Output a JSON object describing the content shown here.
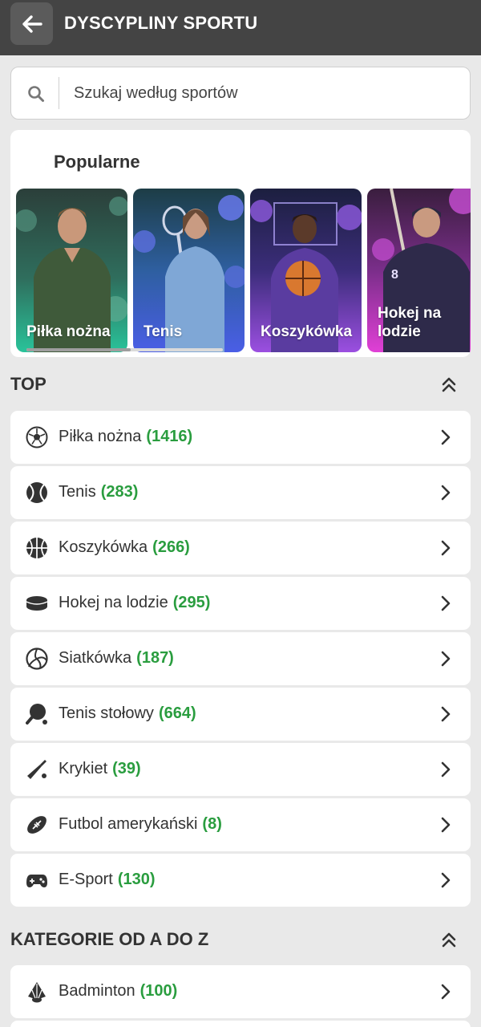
{
  "header": {
    "title": "DYSCYPLINY SPORTU"
  },
  "search": {
    "placeholder": "Szukaj według sportów"
  },
  "popular": {
    "title": "Popularne",
    "cards": [
      {
        "label": "Piłka nożna"
      },
      {
        "label": "Tenis"
      },
      {
        "label": "Koszykówka"
      },
      {
        "label": "Hokej na lodzie"
      }
    ]
  },
  "top": {
    "title": "TOP",
    "items": [
      {
        "label": "Piłka nożna",
        "count": "(1416)",
        "icon": "soccer-ball-icon"
      },
      {
        "label": "Tenis",
        "count": "(283)",
        "icon": "tennis-ball-icon"
      },
      {
        "label": "Koszykówka",
        "count": "(266)",
        "icon": "basketball-icon"
      },
      {
        "label": "Hokej na lodzie",
        "count": "(295)",
        "icon": "hockey-puck-icon"
      },
      {
        "label": "Siatkówka",
        "count": "(187)",
        "icon": "volleyball-icon"
      },
      {
        "label": "Tenis stołowy",
        "count": "(664)",
        "icon": "ping-pong-icon"
      },
      {
        "label": "Krykiet",
        "count": "(39)",
        "icon": "cricket-bat-icon"
      },
      {
        "label": "Futbol amerykański",
        "count": "(8)",
        "icon": "american-football-icon"
      },
      {
        "label": "E-Sport",
        "count": "(130)",
        "icon": "gamepad-icon"
      }
    ]
  },
  "az": {
    "title": "KATEGORIE OD A DO Z",
    "items": [
      {
        "label": "Badminton",
        "count": "(100)",
        "icon": "shuttlecock-icon"
      }
    ]
  },
  "colors": {
    "topbar": "#444444",
    "count_green": "#2a9d3f",
    "background": "#e9e9e9"
  }
}
